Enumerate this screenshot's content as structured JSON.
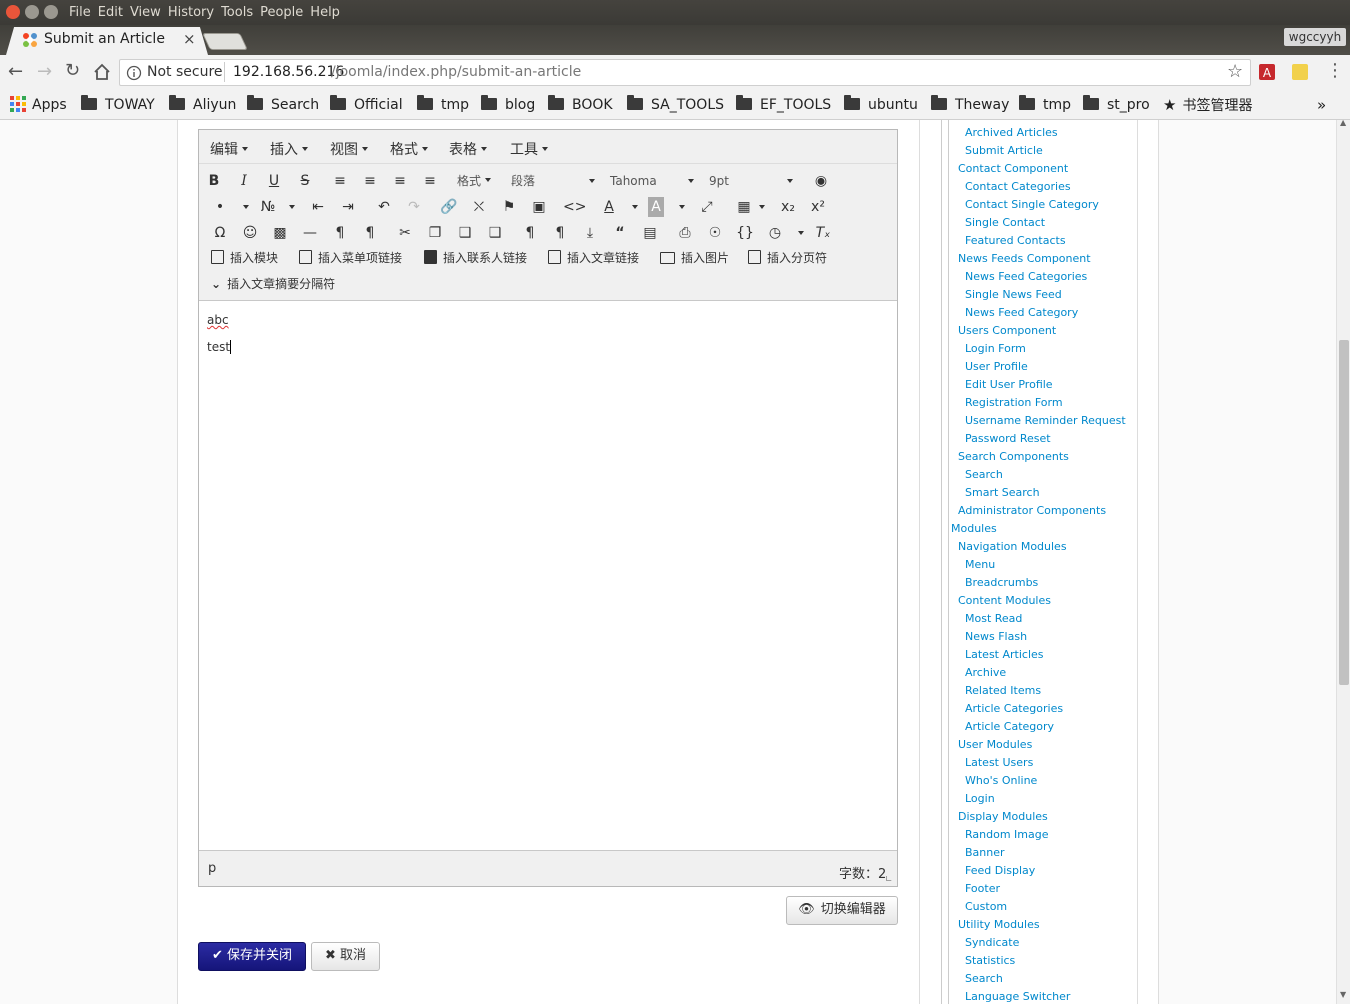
{
  "window": {
    "menu": [
      "File",
      "Edit",
      "View",
      "History",
      "Tools",
      "People",
      "Help"
    ],
    "user_badge": "wgccyyh"
  },
  "tab": {
    "title": "Submit an Article",
    "close": "×"
  },
  "address": {
    "security": "Not secure",
    "host": "192.168.56.216",
    "path": "/joomla/index.php/submit-an-article"
  },
  "bookmarks": [
    "Apps",
    "TOWAY",
    "Aliyun",
    "Search",
    "Official",
    "tmp",
    "blog",
    "BOOK",
    "SA_TOOLS",
    "EF_TOOLS",
    "ubuntu",
    "Theway",
    "tmp",
    "st_pro",
    "书签管理器"
  ],
  "editor": {
    "menus": [
      "编辑",
      "插入",
      "视图",
      "格式",
      "表格",
      "工具"
    ],
    "formats_label": "格式",
    "paragraph_label": "段落",
    "font_label": "Tahoma",
    "size_label": "9pt",
    "insert_buttons": [
      "插入模块",
      "插入菜单项链接",
      "插入联系人链接",
      "插入文章链接",
      "插入图片",
      "插入分页符"
    ],
    "readmore_label": "插入文章摘要分隔符",
    "content": [
      "abc",
      "test"
    ],
    "path": "p",
    "wordcount": "字数：2"
  },
  "buttons": {
    "toggle": "切换编辑器",
    "save": "保存并关闭",
    "cancel": "取消"
  },
  "sidebar": [
    {
      "level": 2,
      "label": "Archived Articles"
    },
    {
      "level": 2,
      "label": "Submit Article"
    },
    {
      "level": 1,
      "label": "Contact Component"
    },
    {
      "level": 2,
      "label": "Contact Categories"
    },
    {
      "level": 2,
      "label": "Contact Single Category"
    },
    {
      "level": 2,
      "label": "Single Contact"
    },
    {
      "level": 2,
      "label": "Featured Contacts"
    },
    {
      "level": 1,
      "label": "News Feeds Component"
    },
    {
      "level": 2,
      "label": "News Feed Categories"
    },
    {
      "level": 2,
      "label": "Single News Feed"
    },
    {
      "level": 2,
      "label": "News Feed Category"
    },
    {
      "level": 1,
      "label": "Users Component"
    },
    {
      "level": 2,
      "label": "Login Form"
    },
    {
      "level": 2,
      "label": "User Profile"
    },
    {
      "level": 2,
      "label": "Edit User Profile"
    },
    {
      "level": 2,
      "label": "Registration Form"
    },
    {
      "level": 2,
      "label": "Username Reminder Request"
    },
    {
      "level": 2,
      "label": "Password Reset"
    },
    {
      "level": 1,
      "label": "Search Components"
    },
    {
      "level": 2,
      "label": "Search"
    },
    {
      "level": 2,
      "label": "Smart Search"
    },
    {
      "level": 1,
      "label": "Administrator Components"
    },
    {
      "level": 0,
      "label": "Modules"
    },
    {
      "level": 1,
      "label": "Navigation Modules"
    },
    {
      "level": 2,
      "label": "Menu"
    },
    {
      "level": 2,
      "label": "Breadcrumbs"
    },
    {
      "level": 1,
      "label": "Content Modules"
    },
    {
      "level": 2,
      "label": "Most Read"
    },
    {
      "level": 2,
      "label": "News Flash"
    },
    {
      "level": 2,
      "label": "Latest Articles"
    },
    {
      "level": 2,
      "label": "Archive"
    },
    {
      "level": 2,
      "label": "Related Items"
    },
    {
      "level": 2,
      "label": "Article Categories"
    },
    {
      "level": 2,
      "label": "Article Category"
    },
    {
      "level": 1,
      "label": "User Modules"
    },
    {
      "level": 2,
      "label": "Latest Users"
    },
    {
      "level": 2,
      "label": "Who's Online"
    },
    {
      "level": 2,
      "label": "Login"
    },
    {
      "level": 1,
      "label": "Display Modules"
    },
    {
      "level": 2,
      "label": "Random Image"
    },
    {
      "level": 2,
      "label": "Banner"
    },
    {
      "level": 2,
      "label": "Feed Display"
    },
    {
      "level": 2,
      "label": "Footer"
    },
    {
      "level": 2,
      "label": "Custom"
    },
    {
      "level": 1,
      "label": "Utility Modules"
    },
    {
      "level": 2,
      "label": "Syndicate"
    },
    {
      "level": 2,
      "label": "Statistics"
    },
    {
      "level": 2,
      "label": "Search"
    },
    {
      "level": 2,
      "label": "Language Switcher"
    }
  ],
  "colors": {
    "link": "#0088cc",
    "primary_button": "#1a1a8c"
  }
}
